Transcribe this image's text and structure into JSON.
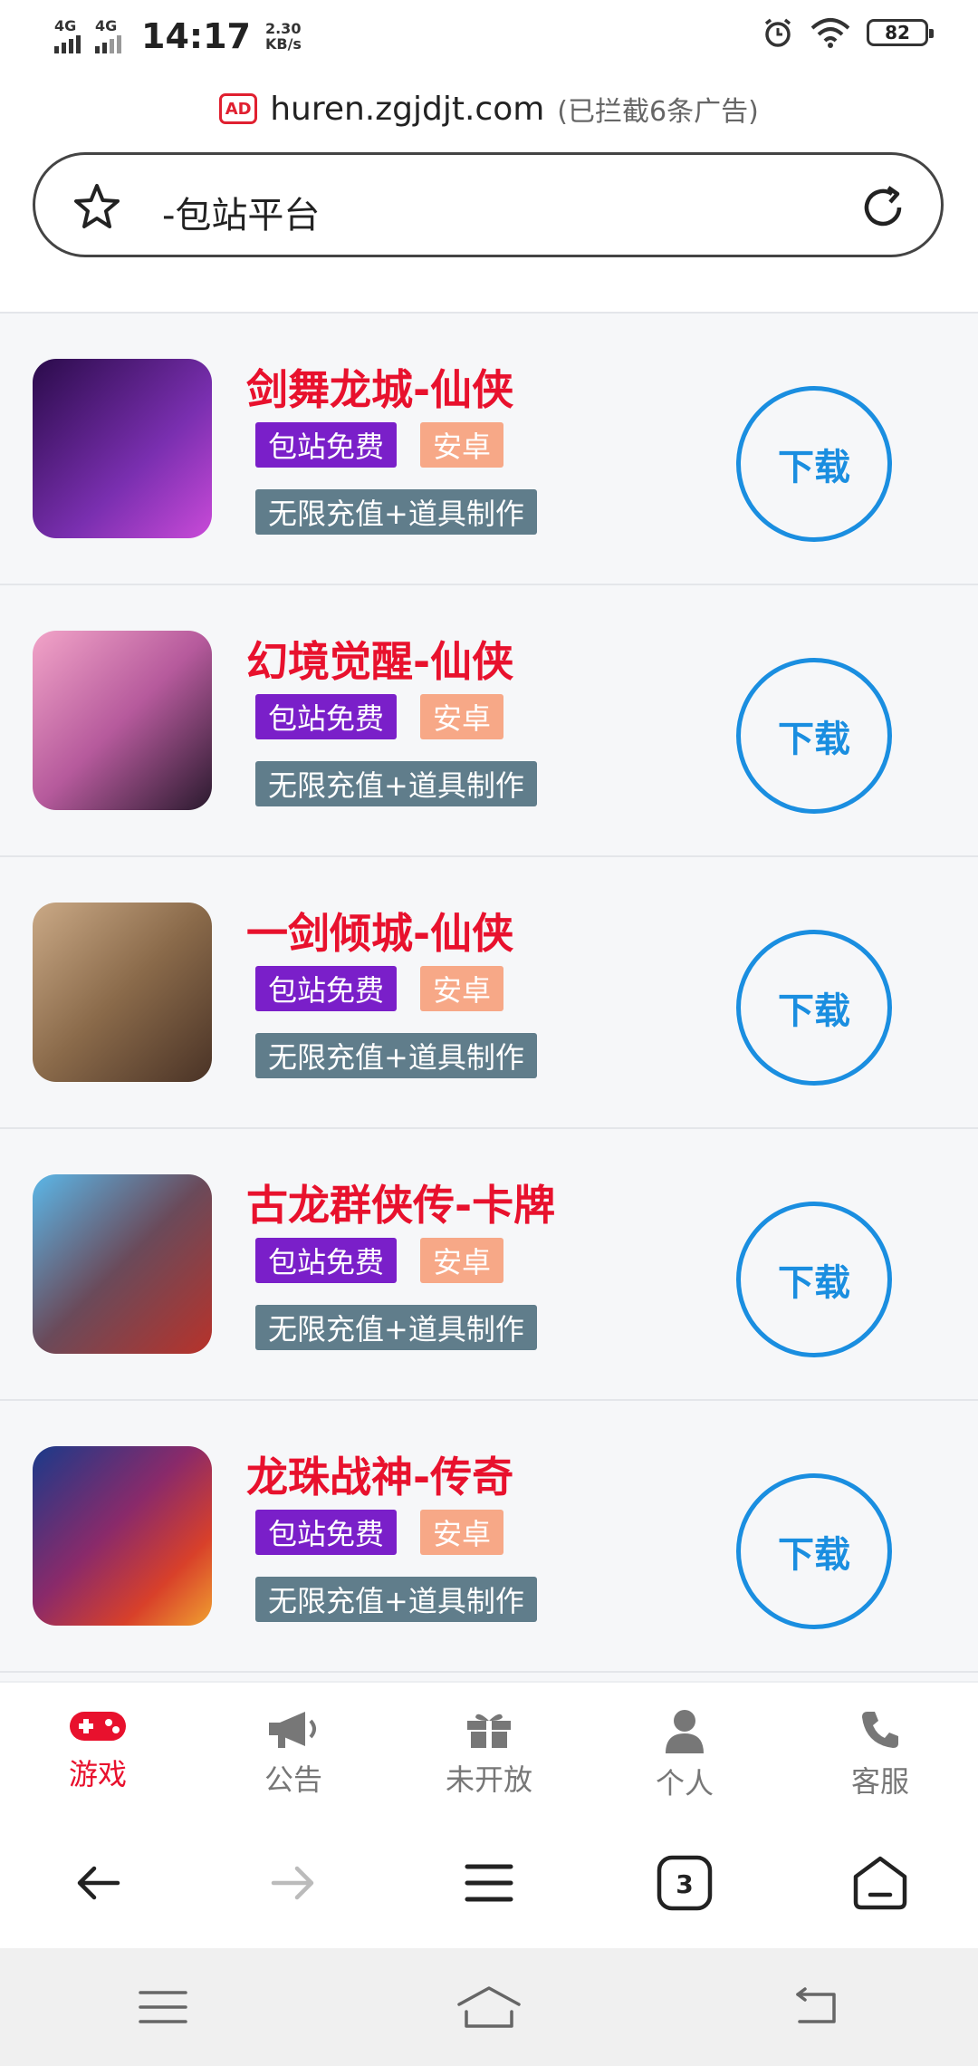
{
  "status_bar": {
    "network1": "4G",
    "network2": "4G",
    "time": "14:17",
    "speed_value": "2.30",
    "speed_unit": "KB/s",
    "battery": "82"
  },
  "browser": {
    "ad_badge": "AD",
    "url": "huren.zgjdjt.com",
    "blocked_ads": "(已拦截6条广告)",
    "page_title": "-包站平台",
    "tab_count": "3"
  },
  "games": [
    {
      "name": "剑舞龙城-仙侠",
      "tag_free": "包站免费",
      "tag_platform": "安卓",
      "feature": "无限充值+道具制作",
      "download": "下载",
      "colors": [
        "#2a0b4a",
        "#7a2fb0"
      ]
    },
    {
      "name": "幻境觉醒-仙侠",
      "tag_free": "包站免费",
      "tag_platform": "安卓",
      "feature": "无限充值+道具制作",
      "download": "下载",
      "colors": [
        "#f2a4c8",
        "#2a1a2e"
      ]
    },
    {
      "name": "一剑倾城-仙侠",
      "tag_free": "包站免费",
      "tag_platform": "安卓",
      "feature": "无限充值+道具制作",
      "download": "下载",
      "colors": [
        "#caa986",
        "#4a3326"
      ]
    },
    {
      "name": "古龙群侠传-卡牌",
      "tag_free": "包站免费",
      "tag_platform": "安卓",
      "feature": "无限充值+道具制作",
      "download": "下载",
      "colors": [
        "#5bb7e8",
        "#2a2a3a"
      ]
    },
    {
      "name": "龙珠战神-传奇",
      "tag_free": "包站免费",
      "tag_platform": "安卓",
      "feature": "无限充值+道具制作",
      "download": "下载",
      "colors": [
        "#1a3a8a",
        "#d8402a"
      ]
    }
  ],
  "tabbar": [
    {
      "label": "游戏",
      "icon": "gamepad-icon",
      "active": true
    },
    {
      "label": "公告",
      "icon": "megaphone-icon"
    },
    {
      "label": "未开放",
      "icon": "gift-icon"
    },
    {
      "label": "个人",
      "icon": "person-icon"
    },
    {
      "label": "客服",
      "icon": "phone-icon"
    }
  ],
  "colors": {
    "accent_red": "#e8112d",
    "download_blue": "#1a8ee0",
    "tag_purple": "#7a1fc9",
    "tag_orange": "#f7a887",
    "feature_gray": "#607d8b"
  }
}
